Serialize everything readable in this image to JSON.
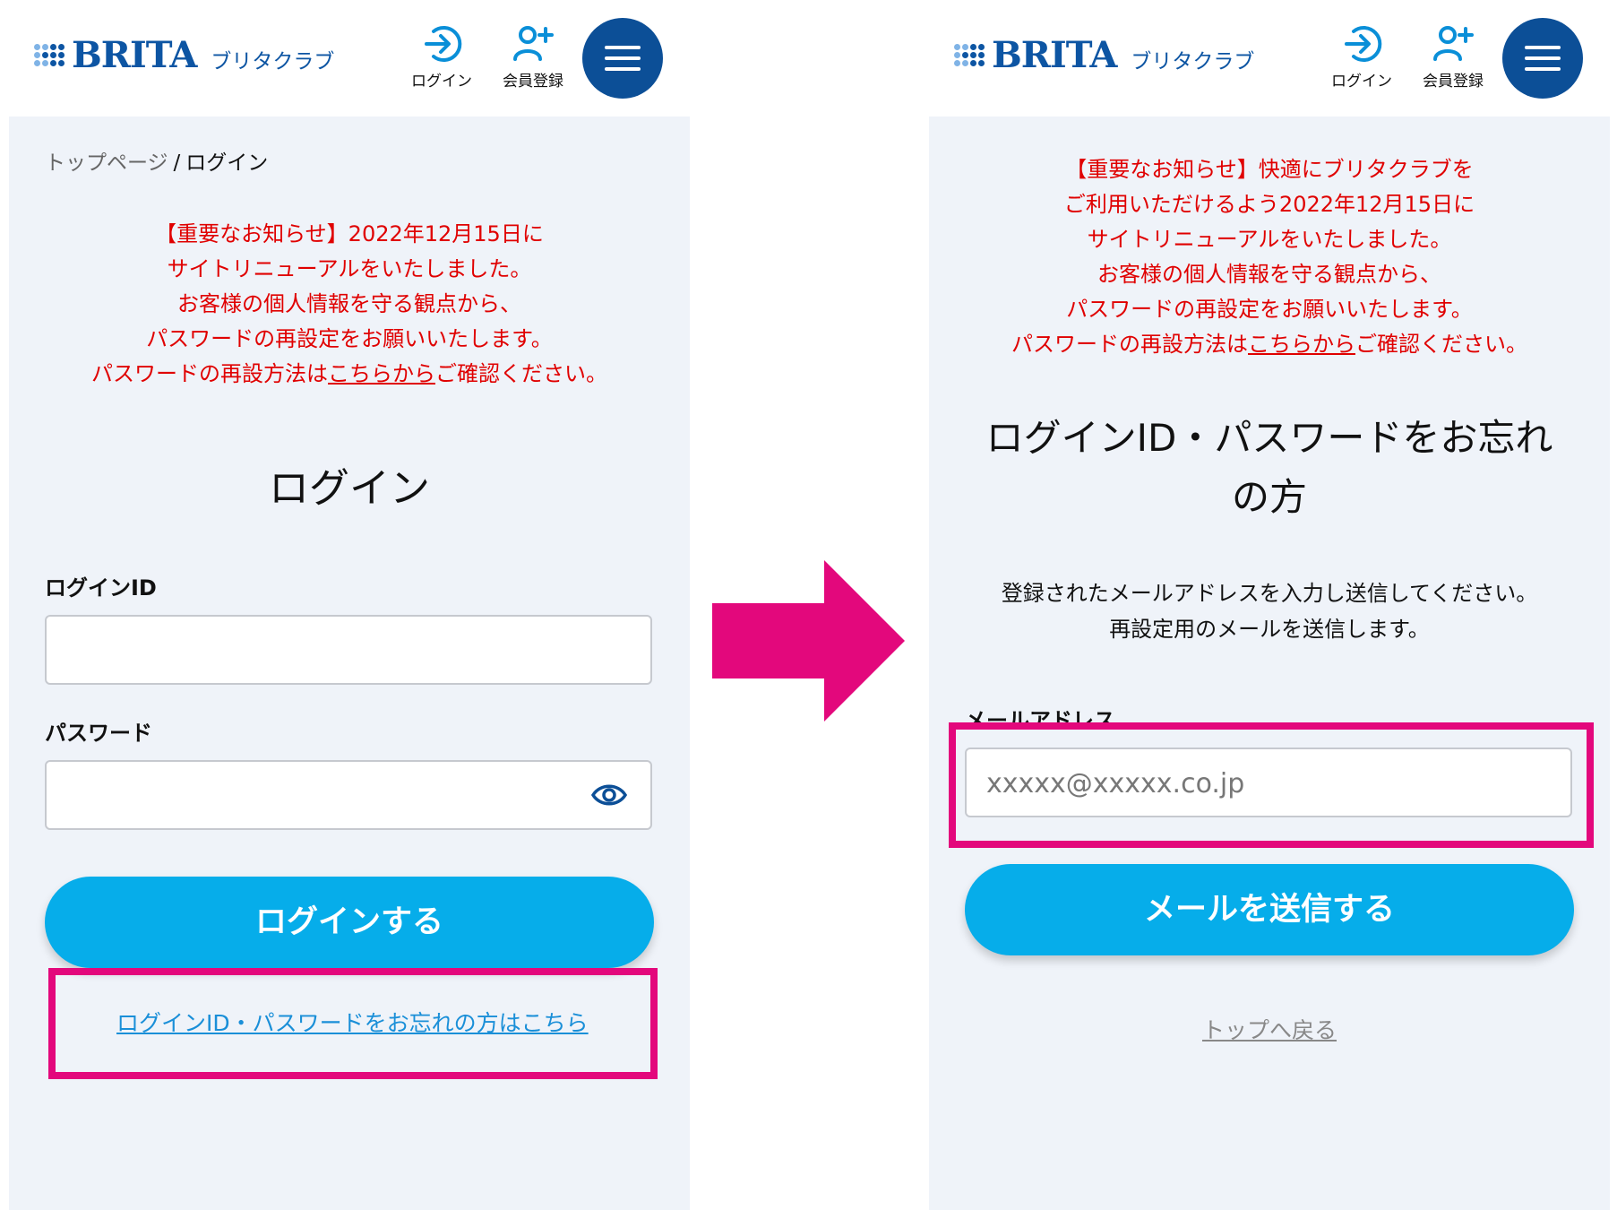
{
  "brand": {
    "name": "BRITA",
    "sub": "ブリタクラブ"
  },
  "header": {
    "login_label": "ログイン",
    "register_label": "会員登録"
  },
  "colors": {
    "accent": "#06adea",
    "brand": "#0c4f97",
    "notice": "#e00000",
    "highlight": "#e3087c",
    "arrow": "#e3087c",
    "panel": "#eff3f9"
  },
  "left": {
    "breadcrumb": {
      "home": "トップページ",
      "sep": "/",
      "current": "ログイン"
    },
    "notice": {
      "lines": [
        "【重要なお知らせ】2022年12月15日に",
        "サイトリニューアルをいたしました。",
        "お客様の個人情報を守る観点から、",
        "パスワードの再設定をお願いいたします。"
      ],
      "last_pre": "パスワードの再設方法は",
      "link": "こちらから",
      "last_post": "ご確認ください。"
    },
    "title": "ログイン",
    "id_label": "ログインID",
    "password_label": "パスワード",
    "id_value": "",
    "password_value": "",
    "submit": "ログインする",
    "forgot": "ログインID・パスワードをお忘れの方はこちら"
  },
  "right": {
    "notice": {
      "lines": [
        "【重要なお知らせ】快適にブリタクラブを",
        "ご利用いただけるよう2022年12月15日に",
        "サイトリニューアルをいたしました。",
        "お客様の個人情報を守る観点から、",
        "パスワードの再設定をお願いいたします。"
      ],
      "last_pre": "パスワードの再設方法は",
      "link": "こちらから",
      "last_post": "ご確認ください。"
    },
    "title_line1": "ログインID・パスワードをお忘れ",
    "title_line2": "の方",
    "desc_line1": "登録されたメールアドレスを入力し送信してください。",
    "desc_line2": "再設定用のメールを送信します。",
    "email_label": "メールアドレス",
    "email_placeholder": "xxxxx@xxxxx.co.jp",
    "email_value": "",
    "submit": "メールを送信する",
    "back": "トップへ戻る"
  }
}
